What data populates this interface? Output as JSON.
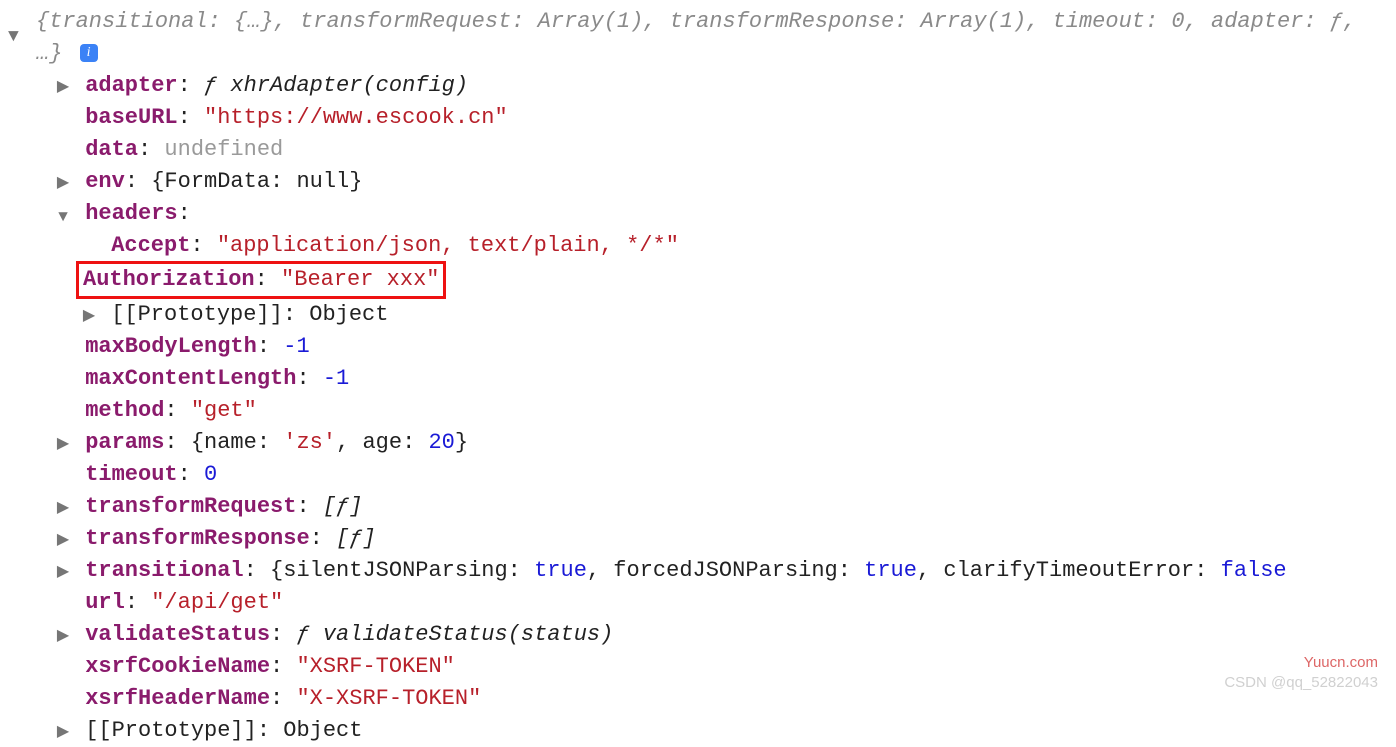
{
  "summary": {
    "text": "{transitional: {…}, transformRequest: Array(1), transformResponse: Array(1), timeout: 0, adapter: ƒ, …}"
  },
  "props": {
    "adapter": {
      "key": "adapter",
      "func": "ƒ xhrAdapter(config)"
    },
    "baseURL": {
      "key": "baseURL",
      "value": "\"https://www.escook.cn\""
    },
    "data": {
      "key": "data",
      "value": "undefined"
    },
    "env": {
      "key": "env",
      "inline": "{FormData: null}"
    },
    "headers": {
      "key": "headers"
    },
    "headers_accept": {
      "key": "Accept",
      "value": "\"application/json, text/plain, */*\""
    },
    "headers_auth": {
      "key": "Authorization",
      "value": "\"Bearer xxx\""
    },
    "headers_proto": {
      "key": "[[Prototype]]",
      "value": "Object"
    },
    "maxBodyLength": {
      "key": "maxBodyLength",
      "value": "-1"
    },
    "maxContentLength": {
      "key": "maxContentLength",
      "value": "-1"
    },
    "method": {
      "key": "method",
      "value": "\"get\""
    },
    "params": {
      "key": "params",
      "inline_prefix": "{name: ",
      "inline_name": "'zs'",
      "inline_mid": ", age: ",
      "inline_age": "20",
      "inline_suffix": "}"
    },
    "timeout": {
      "key": "timeout",
      "value": "0"
    },
    "transformRequest": {
      "key": "transformRequest",
      "inline": "[ƒ]"
    },
    "transformResponse": {
      "key": "transformResponse",
      "inline": "[ƒ]"
    },
    "transitional": {
      "key": "transitional",
      "inline_prefix": "{silentJSONParsing: ",
      "v1": "true",
      "mid1": ", forcedJSONParsing: ",
      "v2": "true",
      "mid2": ", clarifyTimeoutError: ",
      "v3": "false"
    },
    "url": {
      "key": "url",
      "value": "\"/api/get\""
    },
    "validateStatus": {
      "key": "validateStatus",
      "func": "ƒ validateStatus(status)"
    },
    "xsrfCookieName": {
      "key": "xsrfCookieName",
      "value": "\"XSRF-TOKEN\""
    },
    "xsrfHeaderName": {
      "key": "xsrfHeaderName",
      "value": "\"X-XSRF-TOKEN\""
    },
    "proto": {
      "key": "[[Prototype]]",
      "value": "Object"
    }
  },
  "watermarks": {
    "yuucn": "Yuucn.com",
    "csdn": "CSDN @qq_52822043"
  }
}
